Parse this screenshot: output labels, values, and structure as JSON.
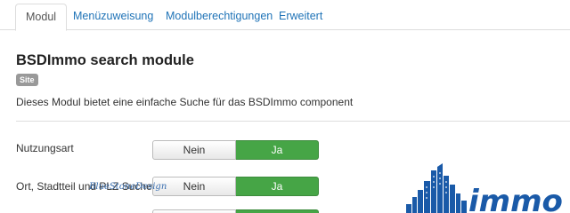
{
  "tabs": [
    {
      "label": "Modul",
      "active": true
    },
    {
      "label": "Menüzuweisung",
      "active": false
    },
    {
      "label": "Modulberechtigungen",
      "active": false
    },
    {
      "label": "Erweitert",
      "active": false
    }
  ],
  "module": {
    "title": "BSDImmo search module",
    "badge": "Site",
    "description": "Dieses Modul bietet eine einfache Suche für das BSDImmo component"
  },
  "fields": [
    {
      "label": "Nutzungsart",
      "options": {
        "no": "Nein",
        "yes": "Ja"
      },
      "selected": "Ja"
    },
    {
      "label": "Ort, Stadtteil und PLZ Suche",
      "options": {
        "no": "Nein",
        "yes": "Ja"
      },
      "selected": "Ja"
    }
  ],
  "logo": {
    "script_text": "BlueStoneDesign",
    "main_text": "immo"
  },
  "colors": {
    "link": "#1f73b7",
    "toggle_active": "#46a546",
    "badge": "#999999",
    "logo_blue": "#1a5aa8"
  },
  "icons": {
    "logo": "skyline-logo-icon"
  }
}
